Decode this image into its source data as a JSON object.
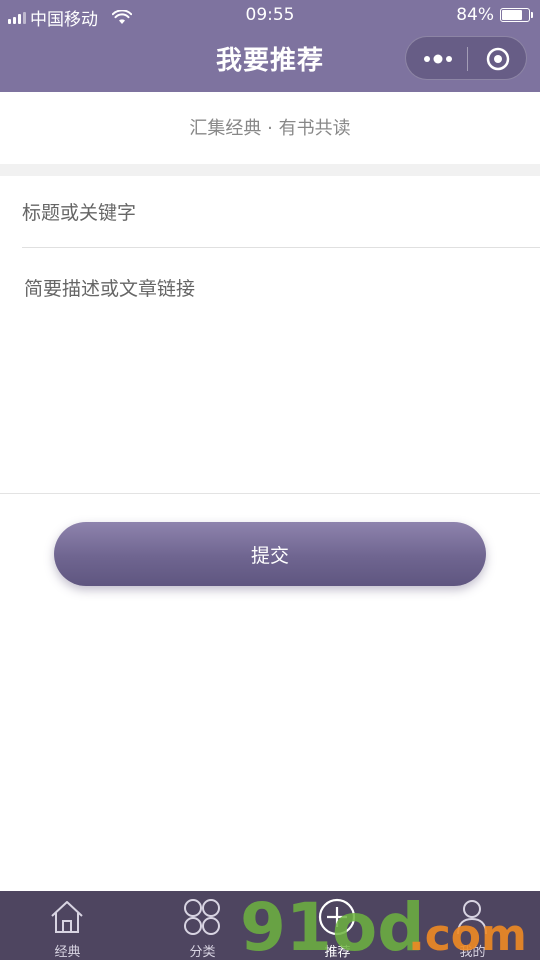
{
  "status_bar": {
    "carrier": "中国移动",
    "time": "09:55",
    "battery": "84%",
    "battery_level": 0.84
  },
  "header": {
    "title": "我要推荐",
    "capsule": {
      "more_icon": "more-dots-icon",
      "close_icon": "target-circle-icon"
    }
  },
  "subtitle": "汇集经典 · 有书共读",
  "form": {
    "title_placeholder": "标题或关键字",
    "title_value": "",
    "description_placeholder": "简要描述或文章链接",
    "description_value": "",
    "submit_label": "提交"
  },
  "tabbar": {
    "items": [
      {
        "label": "经典",
        "icon": "home-icon",
        "active": false
      },
      {
        "label": "分类",
        "icon": "grid-icon",
        "active": false
      },
      {
        "label": "推荐",
        "icon": "plus-circle-icon",
        "active": true
      },
      {
        "label": "我的",
        "icon": "person-icon",
        "active": false
      }
    ]
  },
  "watermark": {
    "text": "91od.com"
  },
  "colors": {
    "header_bg": "#7e739f",
    "tabbar_bg": "#4e4560",
    "button_top": "#8e83ad",
    "button_bottom": "#5f5680"
  }
}
